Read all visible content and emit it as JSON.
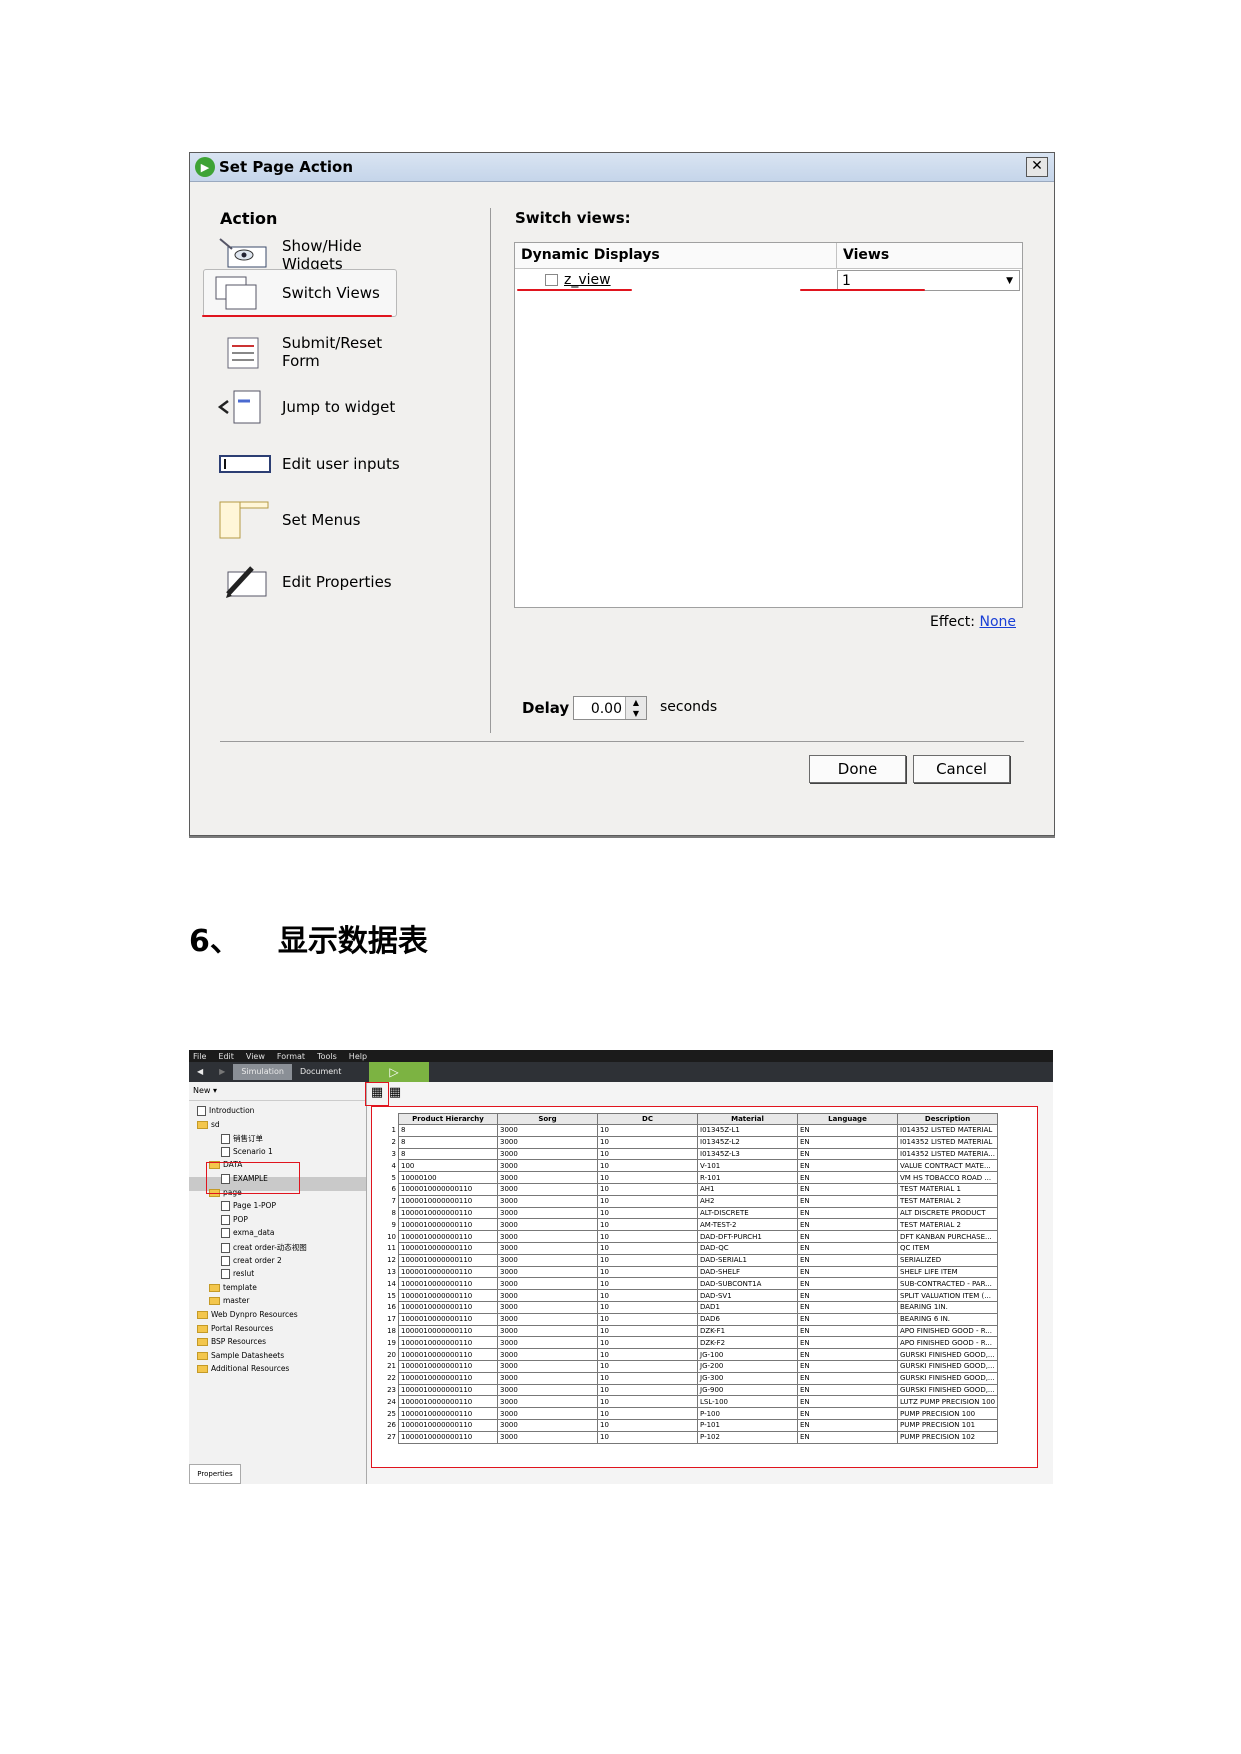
{
  "dialog": {
    "title": "Set Page Action",
    "close_glyph": "✕",
    "action_heading": "Action",
    "actions": [
      {
        "label": "Show/Hide Widgets",
        "icon": "eye-icon"
      },
      {
        "label": "Switch Views",
        "icon": "switch-views-icon"
      },
      {
        "label": "Submit/Reset Form",
        "icon": "form-icon"
      },
      {
        "label": "Jump to widget",
        "icon": "jump-icon"
      },
      {
        "label": "Edit user inputs",
        "icon": "input-icon"
      },
      {
        "label": "Set Menus",
        "icon": "menu-icon"
      },
      {
        "label": "Edit Properties",
        "icon": "pencil-icon"
      }
    ],
    "switch_heading": "Switch views:",
    "table": {
      "col_dynamic": "Dynamic Displays",
      "col_views": "Views",
      "row_dynamic": "z_view",
      "row_views": "1"
    },
    "effect_label": "Effect:",
    "effect_value": "None",
    "delay_label": "Delay",
    "delay_value": "0.00",
    "delay_unit": "seconds",
    "done_label": "Done",
    "cancel_label": "Cancel"
  },
  "section": {
    "number": "6、",
    "title": "显示数据表"
  },
  "app": {
    "menu": [
      "File",
      "Edit",
      "View",
      "Format",
      "Tools",
      "Help"
    ],
    "tabs": [
      "Simulation",
      "Document"
    ],
    "new_label": "New ▾",
    "properties_label": "Properties",
    "tree": [
      {
        "label": "Introduction",
        "level": 0,
        "type": "doc"
      },
      {
        "label": "sd",
        "level": 0,
        "type": "folder"
      },
      {
        "label": "销售订单",
        "level": 2,
        "type": "doc"
      },
      {
        "label": "Scenario 1",
        "level": 2,
        "type": "doc"
      },
      {
        "label": "DATA",
        "level": 1,
        "type": "folder"
      },
      {
        "label": "EXAMPLE",
        "level": 2,
        "type": "doc"
      },
      {
        "label": "page",
        "level": 1,
        "type": "folder"
      },
      {
        "label": "Page 1-POP",
        "level": 2,
        "type": "doc"
      },
      {
        "label": "POP",
        "level": 2,
        "type": "doc"
      },
      {
        "label": "exma_data",
        "level": 2,
        "type": "doc"
      },
      {
        "label": "creat order-动态视图",
        "level": 2,
        "type": "doc"
      },
      {
        "label": "creat order 2",
        "level": 2,
        "type": "doc"
      },
      {
        "label": "reslut",
        "level": 2,
        "type": "doc"
      },
      {
        "label": "template",
        "level": 1,
        "type": "folder"
      },
      {
        "label": "master",
        "level": 1,
        "type": "folder"
      },
      {
        "label": "Web Dynpro Resources",
        "level": 0,
        "type": "folder"
      },
      {
        "label": "Portal Resources",
        "level": 0,
        "type": "folder"
      },
      {
        "label": "BSP Resources",
        "level": 0,
        "type": "folder"
      },
      {
        "label": "Sample Datasheets",
        "level": 0,
        "type": "folder"
      },
      {
        "label": "Additional Resources",
        "level": 0,
        "type": "folder"
      }
    ],
    "grid_columns": [
      "Product Hierarchy",
      "Sorg",
      "DC",
      "Material",
      "Language",
      "Description"
    ],
    "grid_rows": [
      [
        "1",
        "8",
        "3000",
        "10",
        "I01345Z-L1",
        "EN",
        "I014352 LISTED MATERIAL"
      ],
      [
        "2",
        "8",
        "3000",
        "10",
        "I01345Z-L2",
        "EN",
        "I014352 LISTED MATERIAL"
      ],
      [
        "3",
        "8",
        "3000",
        "10",
        "I01345Z-L3",
        "EN",
        "I014352 LISTED MATERIA..."
      ],
      [
        "4",
        "100",
        "3000",
        "10",
        "V-101",
        "EN",
        "VALUE CONTRACT MATE..."
      ],
      [
        "5",
        "10000100",
        "3000",
        "10",
        "R-101",
        "EN",
        "VM HS TOBACCO ROAD ..."
      ],
      [
        "6",
        "1000010000000110",
        "3000",
        "10",
        "AH1",
        "EN",
        "TEST MATERIAL 1"
      ],
      [
        "7",
        "1000010000000110",
        "3000",
        "10",
        "AH2",
        "EN",
        "TEST MATERIAL 2"
      ],
      [
        "8",
        "1000010000000110",
        "3000",
        "10",
        "ALT-DISCRETE",
        "EN",
        "ALT DISCRETE PRODUCT"
      ],
      [
        "9",
        "1000010000000110",
        "3000",
        "10",
        "AM-TEST-2",
        "EN",
        "TEST MATERIAL 2"
      ],
      [
        "10",
        "1000010000000110",
        "3000",
        "10",
        "DAD-DFT-PURCH1",
        "EN",
        "DFT KANBAN PURCHASE..."
      ],
      [
        "11",
        "1000010000000110",
        "3000",
        "10",
        "DAD-QC",
        "EN",
        "QC ITEM"
      ],
      [
        "12",
        "1000010000000110",
        "3000",
        "10",
        "DAD-SERIAL1",
        "EN",
        "SERIALIZED"
      ],
      [
        "13",
        "1000010000000110",
        "3000",
        "10",
        "DAD-SHELF",
        "EN",
        "SHELF LIFE ITEM"
      ],
      [
        "14",
        "1000010000000110",
        "3000",
        "10",
        "DAD-SUBCONT1A",
        "EN",
        "SUB-CONTRACTED - PAR..."
      ],
      [
        "15",
        "1000010000000110",
        "3000",
        "10",
        "DAD-SV1",
        "EN",
        "SPLIT VALUATION ITEM (..."
      ],
      [
        "16",
        "1000010000000110",
        "3000",
        "10",
        "DAD1",
        "EN",
        "BEARING 1IN."
      ],
      [
        "17",
        "1000010000000110",
        "3000",
        "10",
        "DAD6",
        "EN",
        "BEARING 6 IN."
      ],
      [
        "18",
        "1000010000000110",
        "3000",
        "10",
        "DZK-F1",
        "EN",
        "APO FINISHED GOOD - R..."
      ],
      [
        "19",
        "1000010000000110",
        "3000",
        "10",
        "DZK-F2",
        "EN",
        "APO FINISHED GOOD - R..."
      ],
      [
        "20",
        "1000010000000110",
        "3000",
        "10",
        "JG-100",
        "EN",
        "GURSKI FINISHED GOOD,..."
      ],
      [
        "21",
        "1000010000000110",
        "3000",
        "10",
        "JG-200",
        "EN",
        "GURSKI FINISHED GOOD,..."
      ],
      [
        "22",
        "1000010000000110",
        "3000",
        "10",
        "JG-300",
        "EN",
        "GURSKI FINISHED GOOD,..."
      ],
      [
        "23",
        "1000010000000110",
        "3000",
        "10",
        "JG-900",
        "EN",
        "GURSKI FINISHED GOOD,..."
      ],
      [
        "24",
        "1000010000000110",
        "3000",
        "10",
        "LSL-100",
        "EN",
        "LUTZ PUMP PRECISION 100"
      ],
      [
        "25",
        "1000010000000110",
        "3000",
        "10",
        "P-100",
        "EN",
        "PUMP PRECISION 100"
      ],
      [
        "26",
        "1000010000000110",
        "3000",
        "10",
        "P-101",
        "EN",
        "PUMP PRECISION 101"
      ],
      [
        "27",
        "1000010000000110",
        "3000",
        "10",
        "P-102",
        "EN",
        "PUMP PRECISION 102"
      ]
    ]
  },
  "colors": {
    "annotation_red": "#e0141e",
    "link_blue": "#1a3fd6",
    "title_bar": "#c5d5ea"
  }
}
